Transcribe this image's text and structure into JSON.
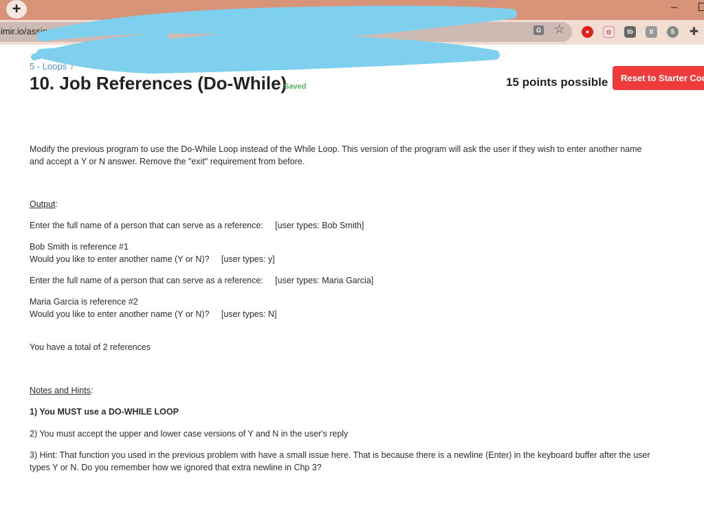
{
  "browser": {
    "new_tab_label": "+",
    "minimize_label": "–",
    "url": "s.mimir.io/assignment",
    "translate_label": "G",
    "star_label": "☆",
    "extensions": [
      "adblock-icon",
      "dino-icon",
      "tb-icon",
      "tl-icon",
      "s-icon",
      "puzzle-icon"
    ],
    "extension_labels": {
      "tb": "tb",
      "tl": "tl",
      "s": "S",
      "puzzle": "✚"
    }
  },
  "breadcrumb": {
    "link": "5 - Loops",
    "separator": "/"
  },
  "header": {
    "title": "10. Job References (Do-While)",
    "saved": "Saved",
    "points": "15 points possible",
    "reset_button": "Reset to Starter Code"
  },
  "instructions": {
    "intro_line1": "Modify the previous program to use the Do-While Loop instead of the While Loop. This version of the program will ask the user if they wish to enter another name",
    "intro_line2": "and accept a Y or N answer. Remove the \"exit\" requirement from before.",
    "output_heading": "Output",
    "output_colon": ":",
    "out1": "Enter the full name of a person that can serve as a reference:     [user types: Bob Smith]",
    "out2a": "Bob Smith is reference #1",
    "out2b": "Would you like to enter another name (Y or N)?     [user types: y]",
    "out3": "Enter the full name of a person that can serve as a reference:     [user types: Maria Garcia]",
    "out4a": "Maria Garcia is reference #2",
    "out4b": "Would you like to enter another name (Y or N)?     [user types: N]",
    "out5": "You have a total of 2 references",
    "notes_heading": "Notes and Hints",
    "notes_colon": ":",
    "hint1": "1) You MUST use a DO-WHILE LOOP",
    "hint2": "2) You must accept the upper and lower case versions of Y and N in the user's reply",
    "hint3a": "3) Hint: That function you used in the previous problem with have a small issue here. That is because there is a newline (Enter) in the keyboard buffer after the user",
    "hint3b": "types Y or N. Do you remember how we ignored that extra newline in Chp 3?"
  },
  "colors": {
    "accent": "#4a90d9",
    "danger": "#ef3b3b",
    "saved": "#5cb85c",
    "tabstrip": "#d89478"
  }
}
